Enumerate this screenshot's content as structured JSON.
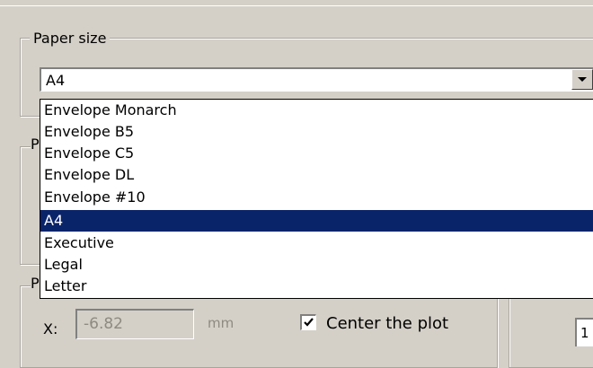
{
  "paper_size": {
    "legend": "Paper size",
    "selected_value": "A4",
    "options": [
      "Envelope Monarch",
      "Envelope B5",
      "Envelope C5",
      "Envelope DL",
      "Envelope #10",
      "A4",
      "Executive",
      "Legal",
      "Letter"
    ],
    "selected_index": 5
  },
  "partial_labels": {
    "group2": "P",
    "group3": "P"
  },
  "plot_offset": {
    "x_label": "X:",
    "x_value": "-6.82",
    "x_unit": "mm",
    "center_checked": true,
    "center_label": "Center the plot"
  },
  "right_field": {
    "value": "1"
  },
  "colors": {
    "highlight": "#0a246a",
    "dialog_bg": "#d4d0c8"
  }
}
